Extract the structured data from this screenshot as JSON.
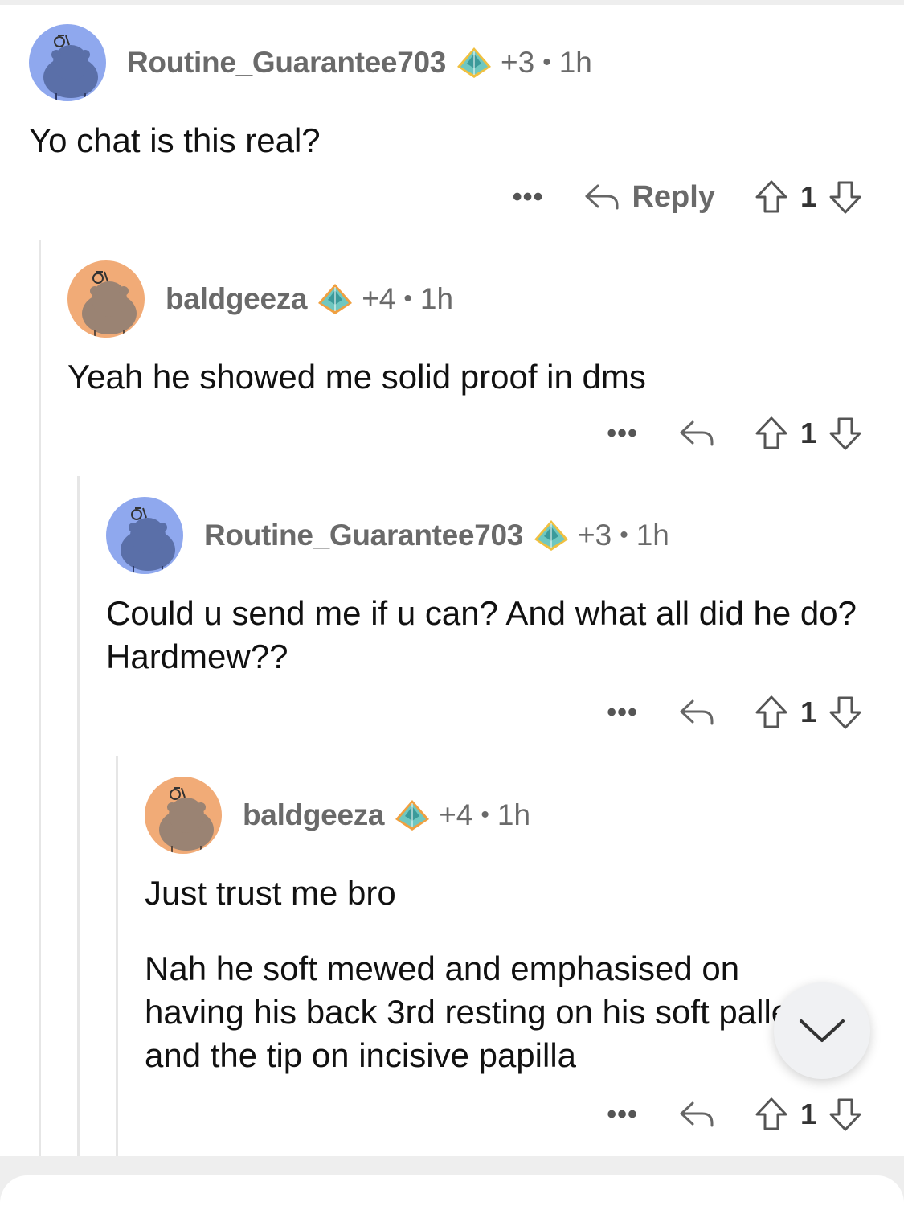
{
  "comments": [
    {
      "username": "Routine_Guarantee703",
      "karma": "+3",
      "separator": "•",
      "age": "1h",
      "body": [
        "Yo chat is this real?"
      ],
      "more": "•••",
      "reply_label": "Reply",
      "votes": "1",
      "avatar_color": "#8fa8ee"
    },
    {
      "username": "baldgeeza",
      "karma": "+4",
      "separator": "•",
      "age": "1h",
      "body": [
        "Yeah he showed me solid proof in dms"
      ],
      "more": "•••",
      "votes": "1",
      "avatar_color": "#f1ab77"
    },
    {
      "username": "Routine_Guarantee703",
      "karma": "+3",
      "separator": "•",
      "age": "1h",
      "body": [
        "Could u send me if u can? And what all did he do? Hardmew??"
      ],
      "more": "•••",
      "votes": "1",
      "avatar_color": "#8fa8ee"
    },
    {
      "username": "baldgeeza",
      "karma": "+4",
      "separator": "•",
      "age": "1h",
      "body": [
        "Just trust me bro",
        "Nah he soft mewed and emphasised on having his back 3rd resting on his soft pallet and the tip on incisive papilla"
      ],
      "more": "•••",
      "votes": "1",
      "avatar_color": "#f1ab77"
    }
  ],
  "icons": {
    "avatar": "snoo-avatar-icon",
    "flair": "crystal-pyramid-icon",
    "reply": "reply-arrow-icon",
    "upvote": "upvote-arrow-icon",
    "downvote": "downvote-arrow-icon",
    "scroll": "chevron-down-icon"
  },
  "colors": {
    "meta_text": "#6a6a6a",
    "thread_line": "#e6e6e6",
    "avatar_blue": "#8fa8ee",
    "avatar_orange": "#f1ab77"
  }
}
